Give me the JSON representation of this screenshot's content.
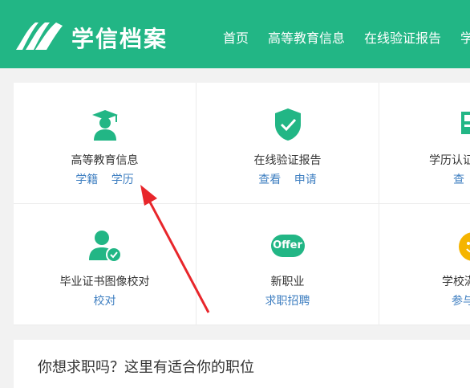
{
  "header": {
    "logo_text": "学信档案",
    "nav": [
      "首页",
      "高等教育信息",
      "在线验证报告",
      "学"
    ]
  },
  "cells": [
    {
      "title": "高等教育信息",
      "links": [
        "学籍",
        "学历"
      ],
      "icon": "graduate-icon"
    },
    {
      "title": "在线验证报告",
      "links": [
        "查看",
        "申请"
      ],
      "icon": "shield-check-icon"
    },
    {
      "title": "学历认证与",
      "links": [
        "查"
      ],
      "icon": "certificate-icon"
    },
    {
      "title": "毕业证书图像校对",
      "links": [
        "校对"
      ],
      "icon": "user-check-icon"
    },
    {
      "title": "新职业",
      "links": [
        "求职招聘"
      ],
      "icon": "offer-icon"
    },
    {
      "title": "学校滿",
      "links": [
        "参与"
      ],
      "icon": "smile-icon"
    }
  ],
  "offer_badge": "Offer",
  "bottom": {
    "text": "你想求职吗？这里有适合你的职位"
  },
  "colors": {
    "brand": "#22b685",
    "link": "#3f7fc1",
    "arrow": "#e8262b",
    "smile": "#f5b400"
  }
}
